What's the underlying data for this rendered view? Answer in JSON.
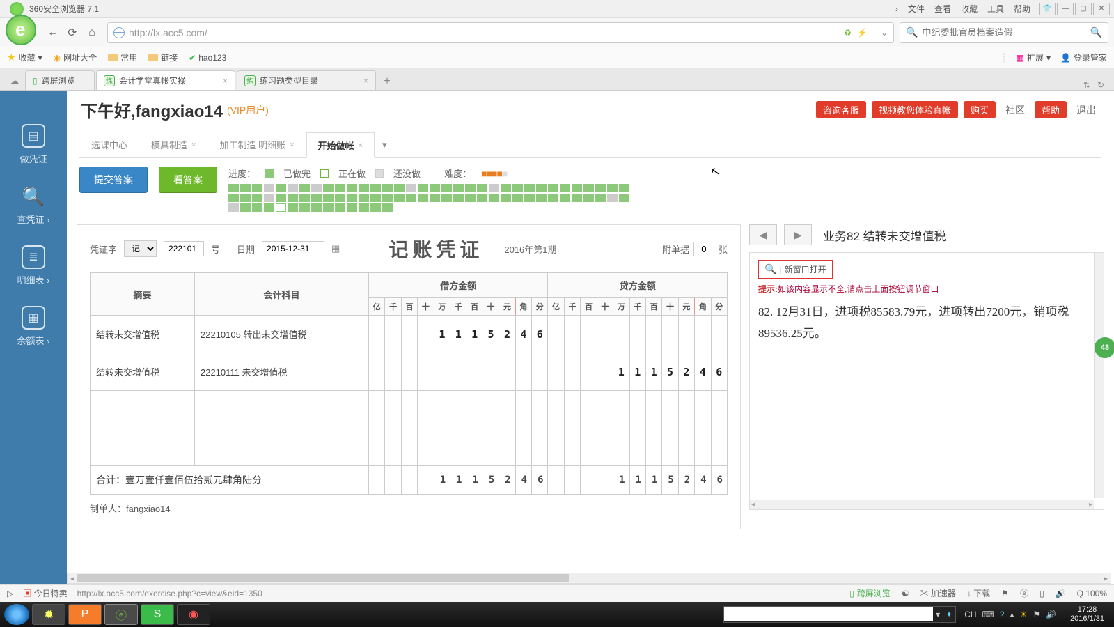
{
  "browser": {
    "title": "360安全浏览器 7.1",
    "url": "http://lx.acc5.com/",
    "search_placeholder": "中纪委批官员档案造假",
    "menus": [
      "文件",
      "查看",
      "收藏",
      "工具",
      "帮助"
    ],
    "bookmarks": {
      "fav": "收藏",
      "items": [
        "网址大全",
        "常用",
        "链接",
        "hao123"
      ],
      "ext": "扩展",
      "login": "登录管家"
    },
    "tabs": [
      {
        "label": "跨屏浏览",
        "badge": "▯"
      },
      {
        "label": "会计学堂真帐实操",
        "badge": "练"
      },
      {
        "label": "练习题类型目录",
        "badge": "练"
      }
    ]
  },
  "app": {
    "sidebar": [
      {
        "label": "做凭证"
      },
      {
        "label": "查凭证 ›"
      },
      {
        "label": "明细表 ›"
      },
      {
        "label": "余额表 ›"
      }
    ],
    "header": {
      "greeting": "下午好,fangxiao14",
      "vip": "(VIP用户)",
      "buttons": {
        "consult": "咨询客服",
        "video": "视频教您体验真帐",
        "buy": "购买",
        "community": "社区",
        "help": "帮助",
        "exit": "退出"
      }
    },
    "subtabs": {
      "course_center": "选课中心",
      "t1": "模具制造",
      "t2": "加工制造 明细账",
      "active": "开始做帐"
    },
    "controls": {
      "submit": "提交答案",
      "view": "看答案",
      "progress_label": "进度：",
      "done": "已做完",
      "doing": "正在做",
      "todo": "还没做",
      "difficulty_label": "难度："
    },
    "voucher": {
      "prefix_label": "凭证字",
      "prefix_value": "记",
      "number": "222101",
      "number_suffix": "号",
      "date_label": "日期",
      "date_value": "2015-12-31",
      "title": "记账凭证",
      "period": "2016年第1期",
      "attach_label": "附单据",
      "attach_value": "0",
      "attach_suffix": "张",
      "headers": {
        "summary": "摘要",
        "subject": "会计科目",
        "debit": "借方金额",
        "credit": "贷方金额",
        "digits": [
          "亿",
          "千",
          "百",
          "十",
          "万",
          "千",
          "百",
          "十",
          "元",
          "角",
          "分"
        ]
      },
      "rows": [
        {
          "summary": "结转未交增值税",
          "subject": "22210105 转出未交增值税",
          "debit": "1115246",
          "credit": ""
        },
        {
          "summary": "结转未交增值税",
          "subject": "22210111 未交增值税",
          "debit": "",
          "credit": "1115246"
        },
        {
          "summary": "",
          "subject": "",
          "debit": "",
          "credit": ""
        },
        {
          "summary": "",
          "subject": "",
          "debit": "",
          "credit": ""
        }
      ],
      "total_label": "合计：壹万壹仟壹佰伍拾贰元肆角陆分",
      "total_debit": "1115246",
      "total_credit": "1115246",
      "preparer_label": "制单人：",
      "preparer": "fangxiao14"
    },
    "task": {
      "title": "业务82 结转未交增值税",
      "new_window": "新窗口打开",
      "tip_label": "提示:",
      "tip_text": "如该内容显示不全,请点击上面按钮调节窗口",
      "body": "82. 12月31日，进项税85583.79元，进项转出7200元，销项税89536.25元。"
    },
    "float_badge": "48"
  },
  "statusbar": {
    "today": "今日特卖",
    "url": "http://lx.acc5.com/exercise.php?c=view&eid=1350",
    "cross": "跨屏浏览",
    "accel": "加速器",
    "download": "下载",
    "zoom": "Q 100%"
  },
  "taskbar": {
    "time": "17:28",
    "date": "2016/1/31",
    "tray_ch": "CH"
  }
}
